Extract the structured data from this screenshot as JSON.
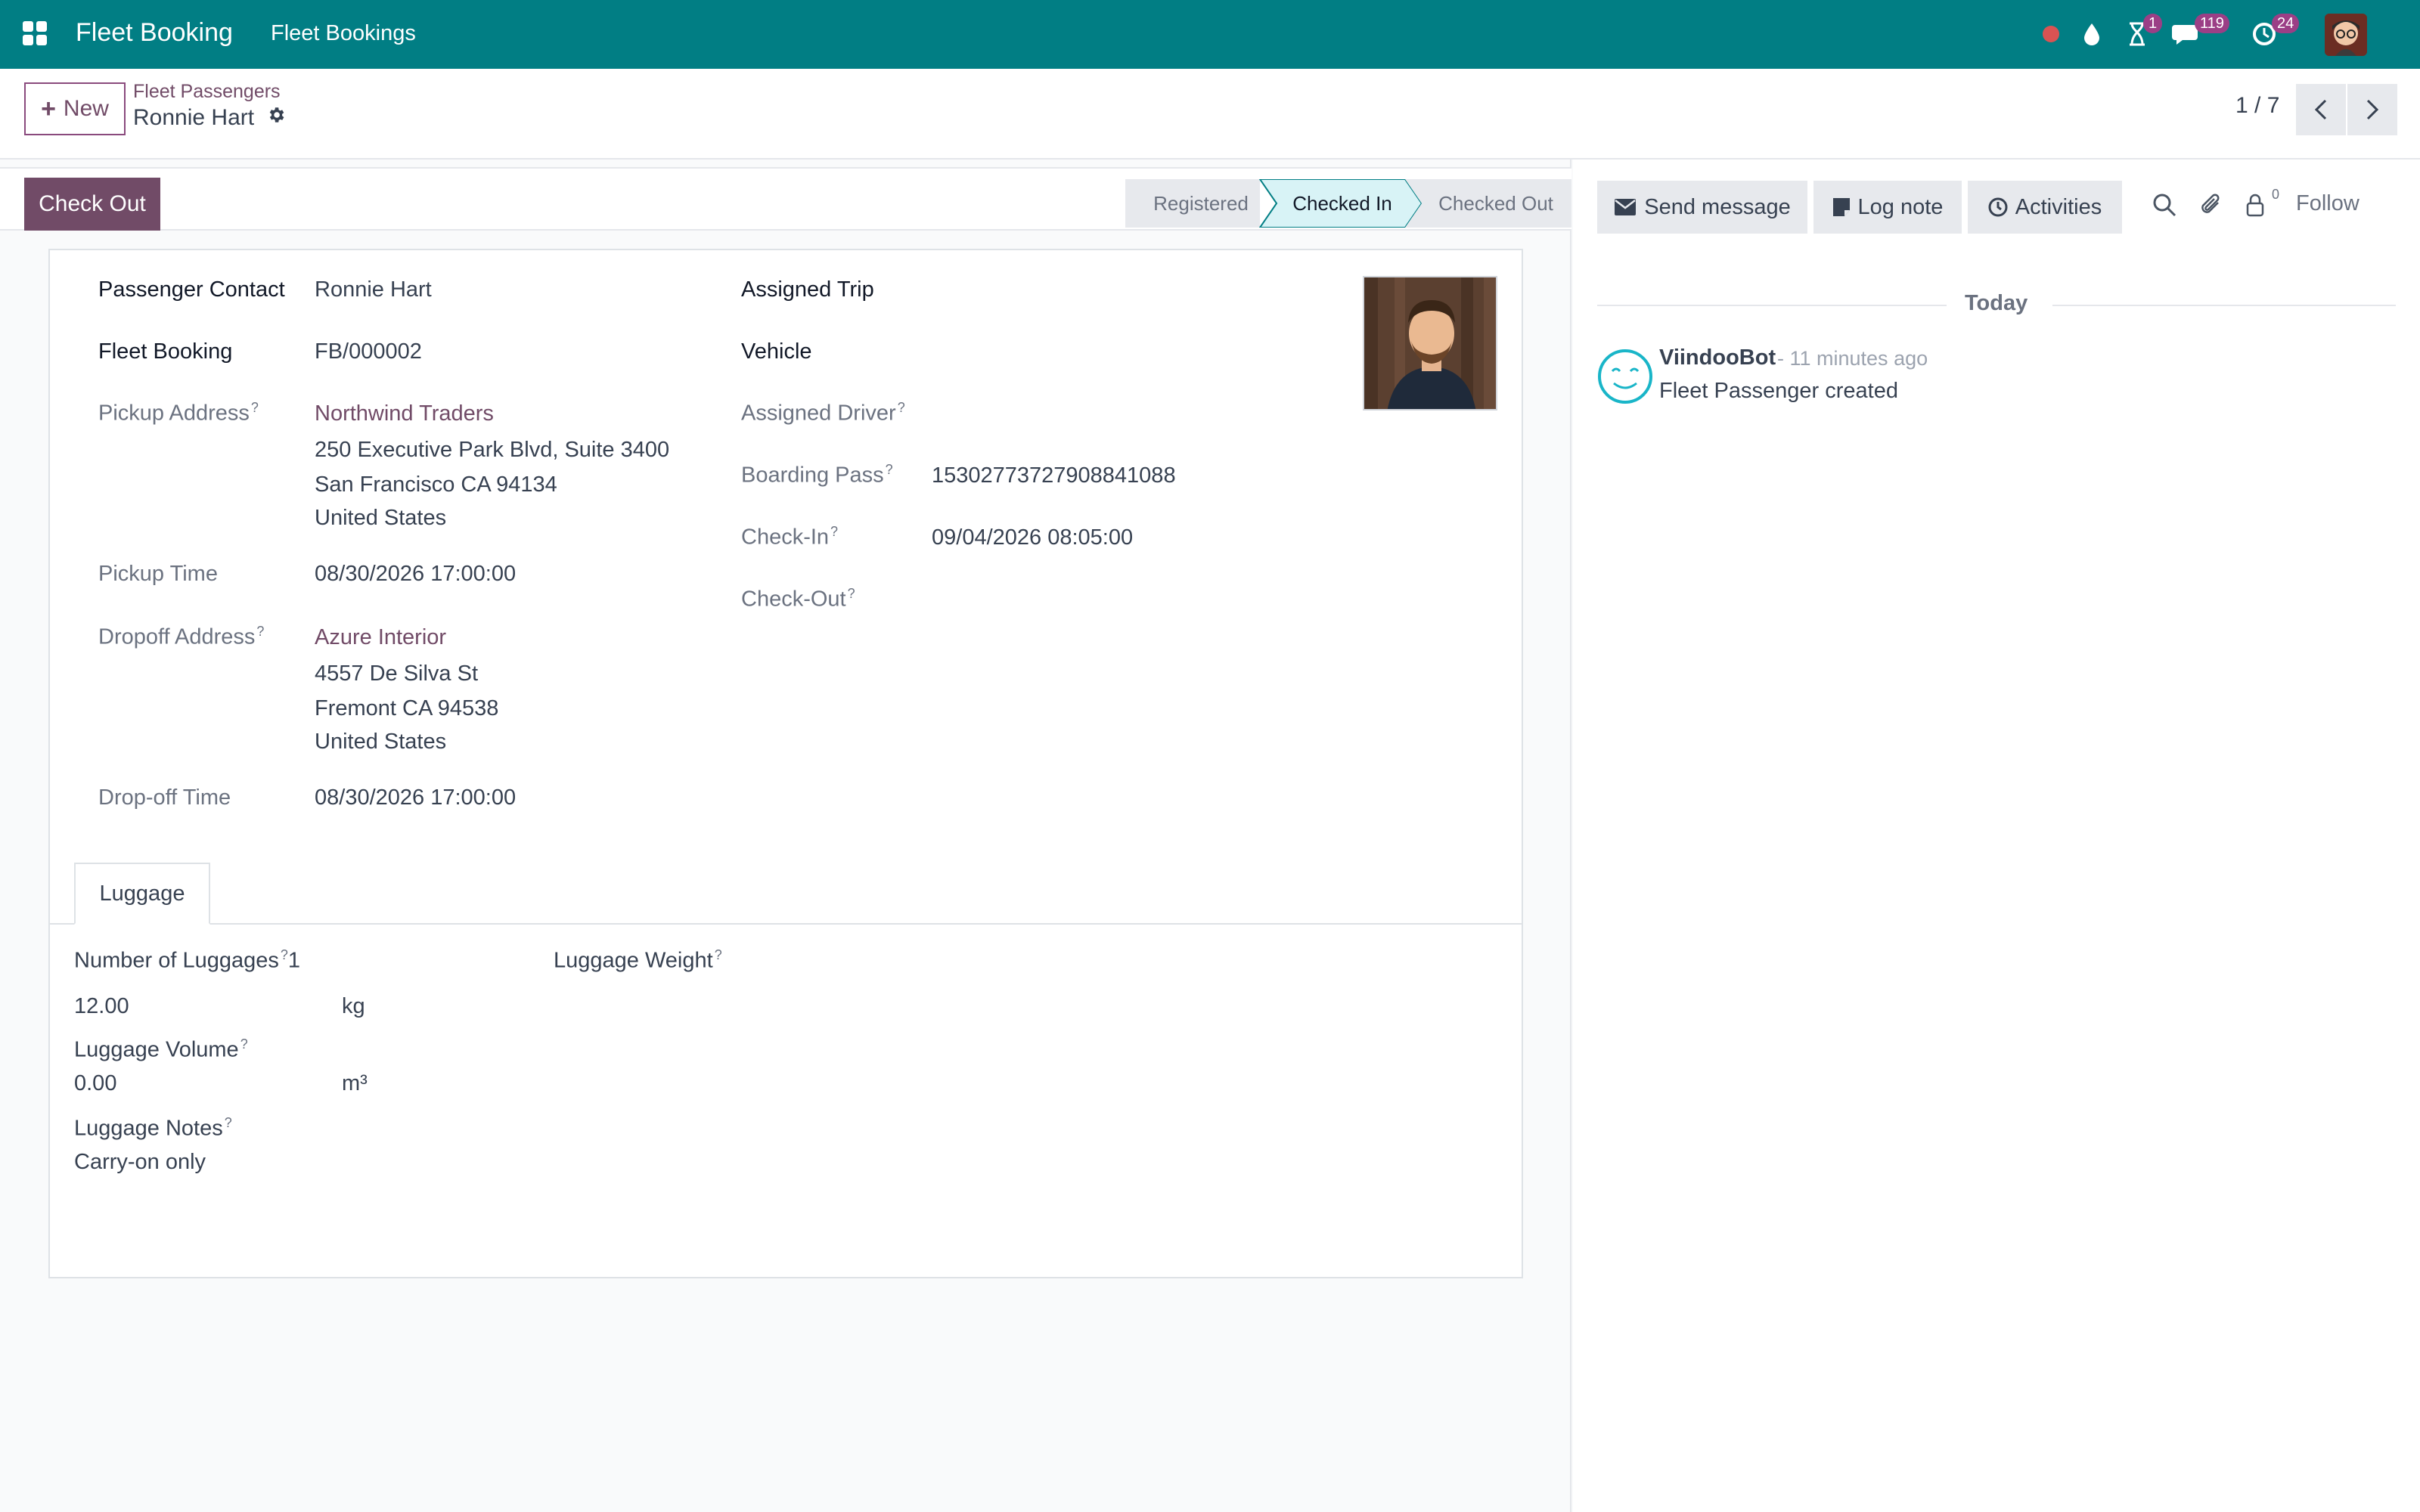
{
  "navbar": {
    "brand": "Fleet Booking",
    "menu_item": "Fleet Bookings",
    "activity_badge": "1",
    "messages_badge": "119",
    "updates_badge": "24",
    "accent_color": "#017e84"
  },
  "control_panel": {
    "new_label": "New",
    "breadcrumb_parent": "Fleet Passengers",
    "breadcrumb_current": "Ronnie Hart",
    "pager_value": "1 / 7"
  },
  "statusbar": {
    "checkout_label": "Check Out",
    "stages": [
      "Registered",
      "Checked In",
      "Checked Out"
    ],
    "current_stage": "Checked In"
  },
  "form": {
    "passenger_contact_label": "Passenger Contact",
    "passenger_contact": "Ronnie Hart",
    "fleet_booking_label": "Fleet Booking",
    "fleet_booking": "FB/000002",
    "pickup_address_label": "Pickup Address",
    "pickup_company": "Northwind Traders",
    "pickup_line1": "250 Executive Park Blvd, Suite 3400",
    "pickup_line2": "San Francisco CA 94134",
    "pickup_line3": "United States",
    "pickup_time_label": "Pickup Time",
    "pickup_time": "08/30/2026 17:00:00",
    "dropoff_address_label": "Dropoff Address",
    "dropoff_company": "Azure Interior",
    "dropoff_line1": "4557 De Silva St",
    "dropoff_line2": "Fremont CA 94538",
    "dropoff_line3": "United States",
    "dropoff_time_label": "Drop-off Time",
    "dropoff_time": "08/30/2026 17:00:00",
    "assigned_trip_label": "Assigned Trip",
    "vehicle_label": "Vehicle",
    "assigned_driver_label": "Assigned Driver",
    "boarding_pass_label": "Boarding Pass",
    "boarding_pass": "15302773727908841088",
    "check_in_label": "Check-In",
    "check_in": "09/04/2026 08:05:00",
    "check_out_label": "Check-Out",
    "help_mark": "?"
  },
  "luggage": {
    "tab_label": "Luggage",
    "number_label": "Number of Luggages",
    "number_value": "1",
    "weight_label": "Luggage Weight",
    "weight_value": "12.00",
    "weight_unit": "kg",
    "volume_label": "Luggage Volume",
    "volume_value": "0.00",
    "volume_unit": "m³",
    "notes_label": "Luggage Notes",
    "notes_value": "Carry-on only"
  },
  "chatter": {
    "send_message_label": "Send message",
    "log_note_label": "Log note",
    "activities_label": "Activities",
    "follower_count": "0",
    "follow_label": "Follow",
    "today_label": "Today",
    "message_author": "ViindooBot",
    "message_time": "- 11 minutes ago",
    "message_body": "Fleet Passenger created"
  }
}
